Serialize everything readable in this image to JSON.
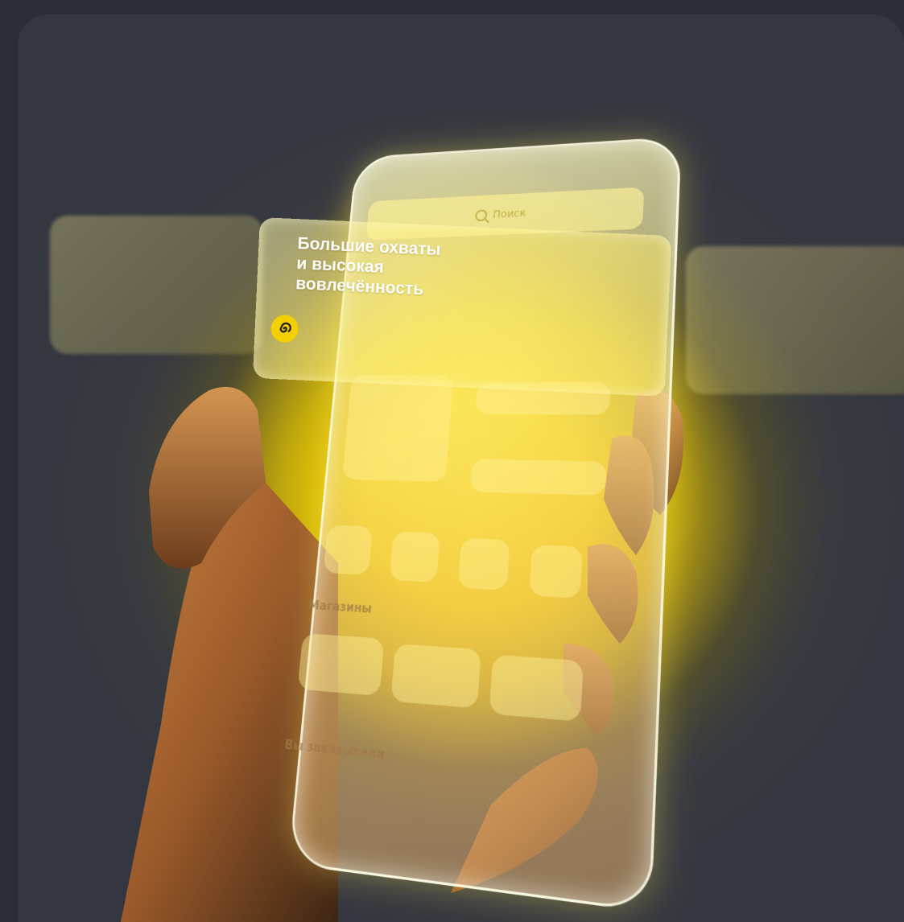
{
  "banner": {
    "title_line1": "Большие охваты",
    "title_line2": "и высокая",
    "title_line3": "вовлечённость",
    "logo_icon": "swirl-logo-icon"
  },
  "phone_ui": {
    "search_placeholder": "Поиск",
    "sections": [
      "Магазины",
      "Вы заказывали"
    ]
  },
  "colors": {
    "accent": "#ffdd00",
    "background": "#2b2e37"
  }
}
